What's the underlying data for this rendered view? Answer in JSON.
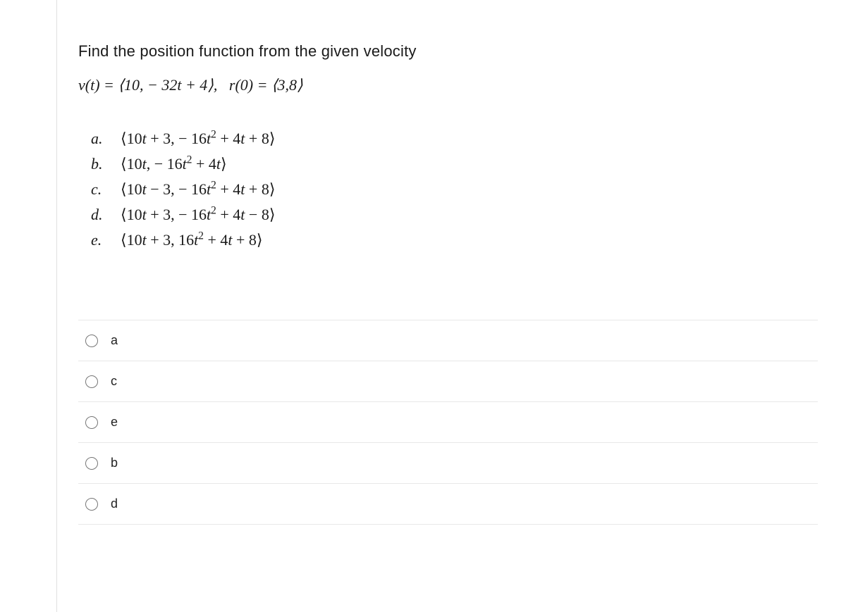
{
  "question": {
    "prompt": "Find the position function from the given velocity",
    "equation_html": "<span class='it'>v</span>(<span class='it'>t</span>) = &lang;10, &minus; 32<span class='it'>t</span> + 4&rang;,&nbsp;&nbsp;&nbsp;<span class='it'>r</span>(0) = &lang;3,8&rang;"
  },
  "answers": [
    {
      "letter": "a.",
      "expr_html": "&lang;10<span class='it'>t</span> + 3, &minus; 16<span class='it'>t</span><sup>2</sup> + 4<span class='it'>t</span> + 8&rang;"
    },
    {
      "letter": "b.",
      "expr_html": "&lang;10<span class='it'>t</span>, &minus; 16<span class='it'>t</span><sup>2</sup> + 4<span class='it'>t</span>&rang;"
    },
    {
      "letter": "c.",
      "expr_html": "&lang;10<span class='it'>t</span> &minus; 3, &minus; 16<span class='it'>t</span><sup>2</sup> + 4<span class='it'>t</span> + 8&rang;"
    },
    {
      "letter": "d.",
      "expr_html": "&lang;10<span class='it'>t</span> + 3, &minus; 16<span class='it'>t</span><sup>2</sup> + 4<span class='it'>t</span> &minus; 8&rang;"
    },
    {
      "letter": "e.",
      "expr_html": "&lang;10<span class='it'>t</span> + 3, 16<span class='it'>t</span><sup>2</sup> + 4<span class='it'>t</span> + 8&rang;"
    }
  ],
  "radio_options": [
    {
      "label": "a"
    },
    {
      "label": "c"
    },
    {
      "label": "e"
    },
    {
      "label": "b"
    },
    {
      "label": "d"
    }
  ]
}
